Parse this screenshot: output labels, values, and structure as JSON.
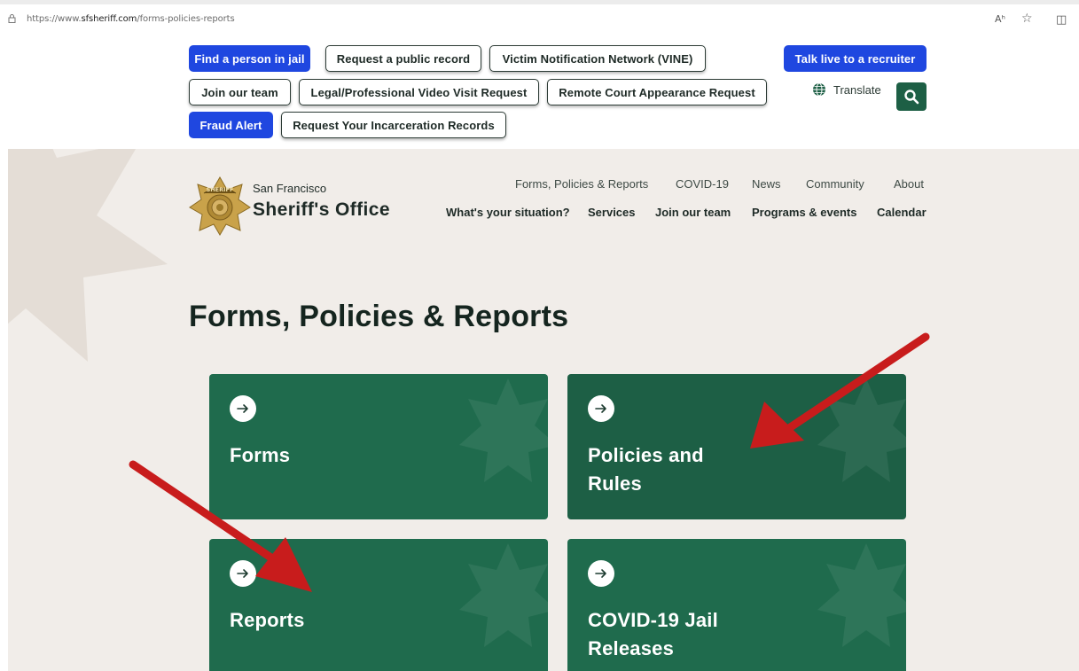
{
  "browser": {
    "url_prefix": "https://www.",
    "url_domain": "sfsheriff.com",
    "url_path": "/forms-policies-reports",
    "read_aloud_icon": "Aʰ",
    "favorite_icon": "☆",
    "reading_view_icon": "◫"
  },
  "utility": {
    "buttons_row1": [
      "Find a person in jail",
      "Request a public record",
      "Victim Notification Network (VINE)"
    ],
    "recruiter": "Talk live to a recruiter",
    "buttons_row2": [
      "Join our team",
      "Legal/Professional Video Visit Request",
      "Remote Court Appearance Request"
    ],
    "translate": "Translate",
    "buttons_row3": [
      "Fraud Alert",
      "Request Your Incarceration Records"
    ]
  },
  "brand": {
    "org_line1": "San Francisco",
    "org_line2": "Sheriff's Office",
    "badge_text": "SHERIFF"
  },
  "nav": {
    "secondary": [
      "Forms, Policies & Reports",
      "COVID-19",
      "News",
      "Community",
      "About"
    ],
    "primary": [
      "What's your situation?",
      "Services",
      "Join our team",
      "Programs & events",
      "Calendar"
    ]
  },
  "page": {
    "title": "Forms, Policies & Reports"
  },
  "cards": [
    {
      "label": "Forms"
    },
    {
      "label": "Policies and\nRules"
    },
    {
      "label": "Reports"
    },
    {
      "label": "COVID-19 Jail\nReleases"
    }
  ],
  "colors": {
    "blue_button": "#1f47e0",
    "card_green": "#1f6b4d",
    "card_green_dark": "#1d5f45",
    "page_bg": "#f1ede9",
    "annotation_arrow": "#c81c1c"
  }
}
